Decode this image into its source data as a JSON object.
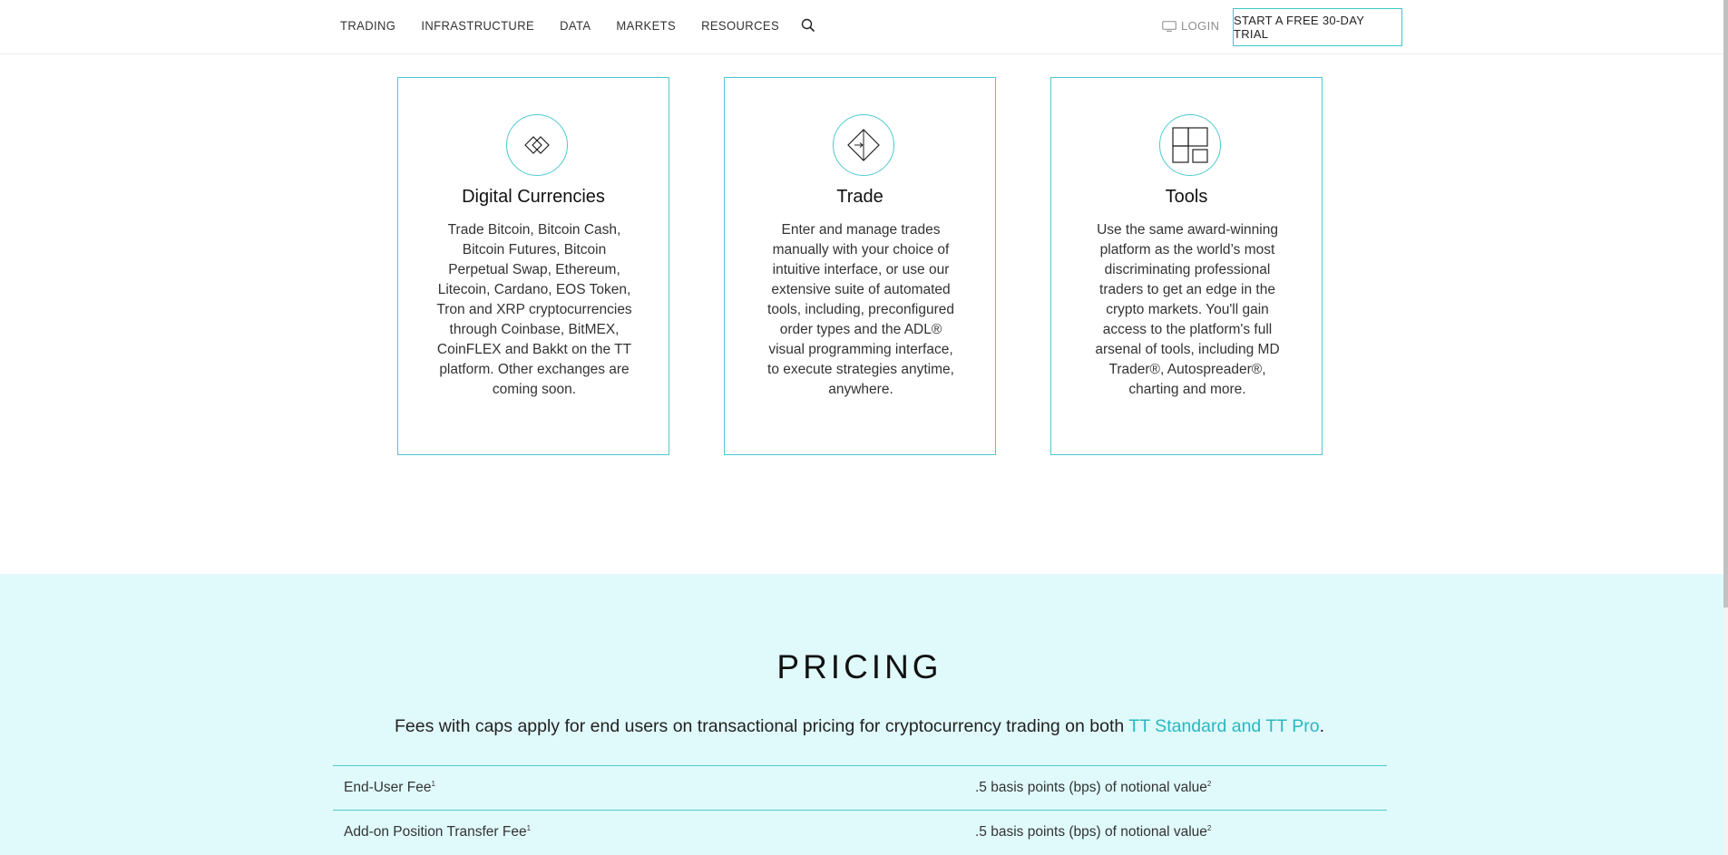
{
  "nav": {
    "items": [
      "TRADING",
      "INFRASTRUCTURE",
      "DATA",
      "MARKETS",
      "RESOURCES"
    ],
    "search_icon": "search-icon",
    "login_label": "LOGIN",
    "login_icon": "monitor-icon",
    "trial_label": "START A FREE 30-DAY TRIAL"
  },
  "cards": [
    {
      "icon": "diamond-pair-icon",
      "title": "Digital Currencies",
      "body": "Trade Bitcoin, Bitcoin Cash, Bitcoin Futures, Bitcoin Perpetual Swap, Ethereum, Litecoin, Cardano, EOS Token, Tron and XRP cryptocurrencies through Coinbase, BitMEX, CoinFLEX and Bakkt on the TT platform. Other exchanges are coming soon."
    },
    {
      "icon": "diamond-arrow-icon",
      "title": "Trade",
      "body": "Enter and manage trades manually with your choice of intuitive interface, or use our extensive suite of automated tools, including, preconfigured order types and the ADL® visual programming interface, to execute strategies anytime, anywhere."
    },
    {
      "icon": "panels-icon",
      "title": "Tools",
      "body": "Use the same award-winning platform as the world’s most discriminating professional traders to get an edge in the crypto markets. You'll gain access to the platform's full arsenal of tools, including MD Trader®, Autospreader®, charting and more."
    }
  ],
  "pricing": {
    "title": "PRICING",
    "desc_prefix": "Fees with caps apply for end users on transactional pricing for cryptocurrency trading on both ",
    "desc_link": "TT Standard and TT Pro",
    "desc_suffix": ".",
    "rows": [
      {
        "label": "End-User Fee",
        "label_sup": "1",
        "value": ".5 basis points (bps) of notional value",
        "value_sup": "2"
      },
      {
        "label": "Add-on Position Transfer Fee",
        "label_sup": "1",
        "value": ".5 basis points (bps) of notional value",
        "value_sup": "2"
      }
    ]
  },
  "colors": {
    "accent": "#4fc9d0",
    "link": "#2ab7bf",
    "pricing_bg": "#e0fafb"
  }
}
